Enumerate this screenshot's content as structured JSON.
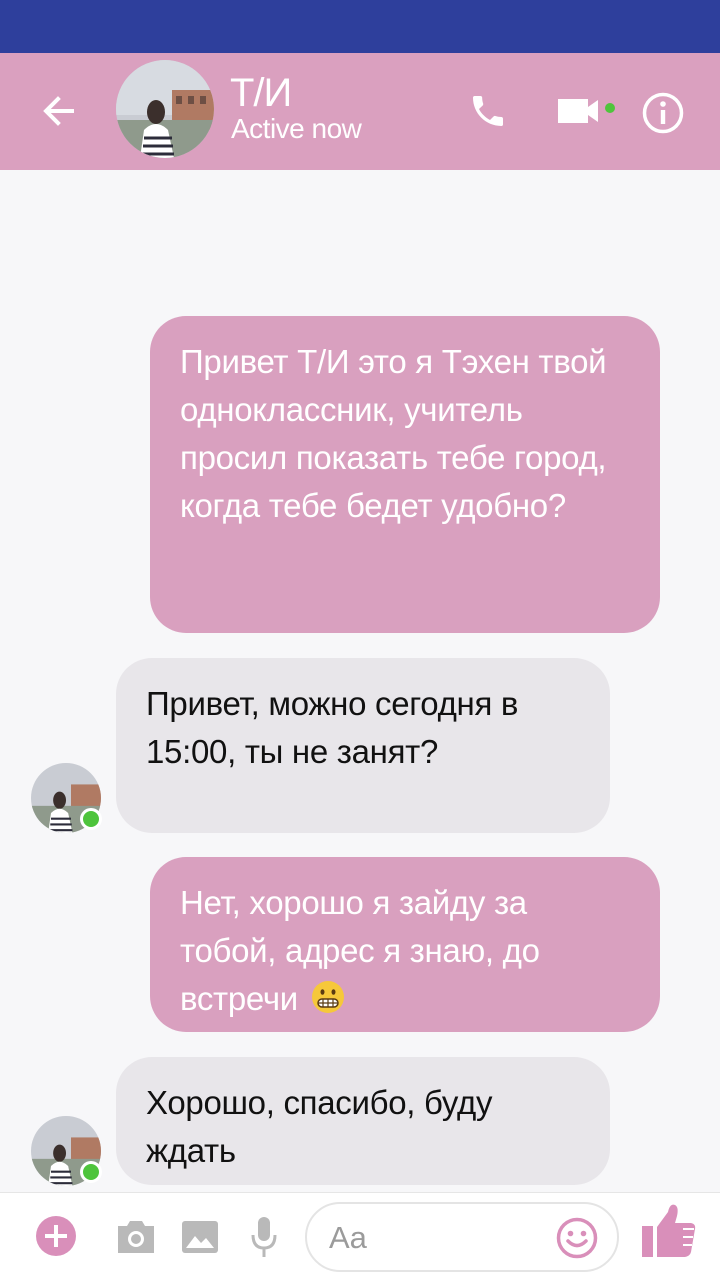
{
  "header": {
    "contact_name": "Т/И",
    "contact_status": "Active now"
  },
  "messages": [
    {
      "direction": "outgoing",
      "text": "Привет Т/И это я Тэхен твой одноклассник, учитель просил показать тебе город, когда тебе бедет удобно?"
    },
    {
      "direction": "incoming",
      "text": "Привет, можно сегодня в 15:00, ты не занят?"
    },
    {
      "direction": "outgoing",
      "text": "Нет, хорошо я зайду за тобой, адрес я знаю, до встречи",
      "emoji": "grimacing-emoji"
    },
    {
      "direction": "incoming",
      "text": "Хорошо, спасибо, буду ждать"
    }
  ],
  "composer": {
    "placeholder": "Aa"
  },
  "colors": {
    "status_bar": "#2e3f9c",
    "header": "#daa0bf",
    "outgoing_bubble": "#d9a0bf",
    "incoming_bubble": "#e8e6ea",
    "online": "#4ec43c",
    "accent_icon": "#d98fba"
  },
  "icons": [
    "back-arrow-icon",
    "phone-icon",
    "video-camera-icon",
    "info-icon",
    "plus-icon",
    "camera-icon",
    "image-icon",
    "microphone-icon",
    "smiley-icon",
    "thumbs-up-icon"
  ]
}
